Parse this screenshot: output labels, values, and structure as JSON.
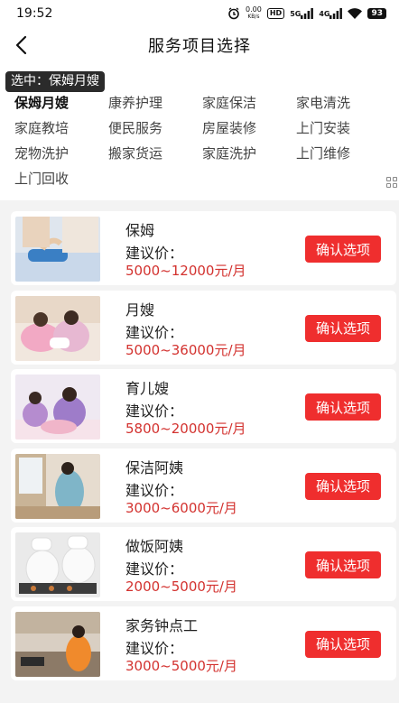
{
  "status_bar": {
    "time": "19:52",
    "net_speed": "0.00",
    "net_unit": "KB/s",
    "hd_badge": "HD",
    "signal_1": "5G",
    "signal_2": "4G",
    "battery": "93"
  },
  "header": {
    "title": "服务项目选择"
  },
  "selected": {
    "text": "选中：保姆月嫂"
  },
  "categories": [
    "保姆月嫂",
    "康养护理",
    "家庭保洁",
    "家电清洗",
    "家庭教培",
    "便民服务",
    "房屋装修",
    "上门安装",
    "宠物洗护",
    "搬家货运",
    "家庭洗护",
    "上门维修",
    "上门回收"
  ],
  "price_label": "建议价：",
  "confirm_label": "确认选项",
  "services": [
    {
      "name": "保姆",
      "price": "5000~12000元/月"
    },
    {
      "name": "月嫂",
      "price": "5000~36000元/月"
    },
    {
      "name": "育儿嫂",
      "price": "5800~20000元/月"
    },
    {
      "name": "保洁阿姨",
      "price": "3000~6000元/月"
    },
    {
      "name": "做饭阿姨",
      "price": "2000~5000元/月"
    },
    {
      "name": "家务钟点工",
      "price": "3000~5000元/月"
    }
  ],
  "colors": {
    "accent": "#ef2e2e",
    "price": "#d3322f",
    "tag_bg": "#2b2b2b"
  }
}
